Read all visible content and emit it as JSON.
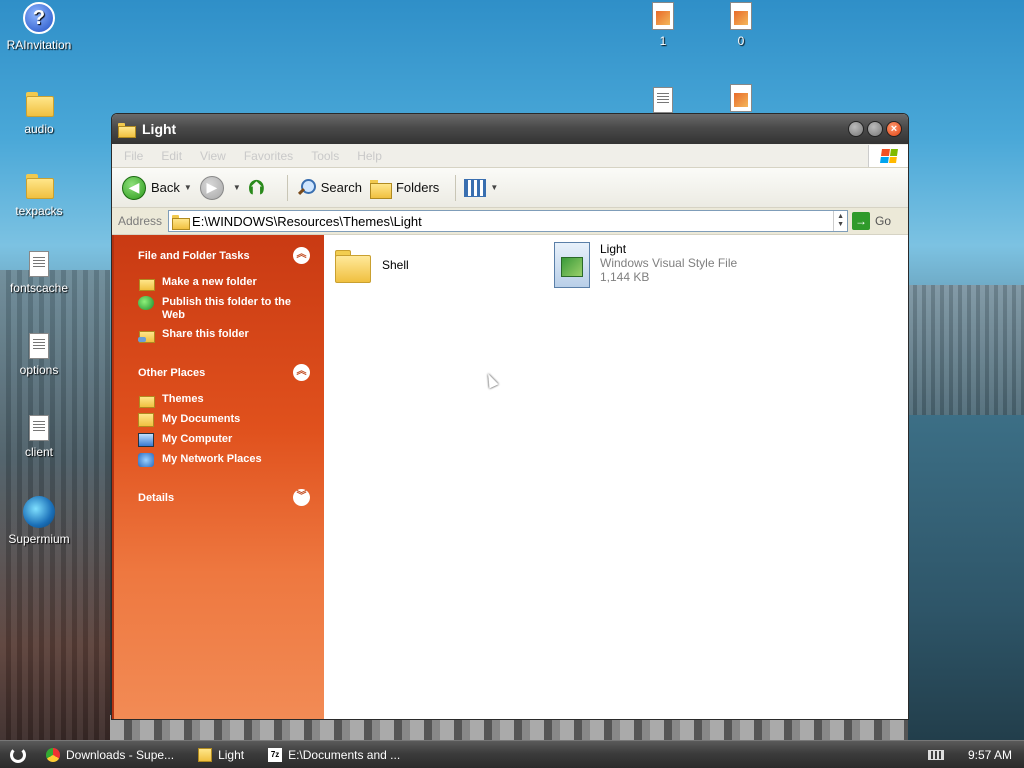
{
  "desktop": {
    "icons": [
      {
        "label": "RAInvitation",
        "icon": "help-icon"
      },
      {
        "label": "audio",
        "icon": "folder-icon"
      },
      {
        "label": "texpacks",
        "icon": "folder-icon"
      },
      {
        "label": "fontscache",
        "icon": "document-icon"
      },
      {
        "label": "options",
        "icon": "document-icon"
      },
      {
        "label": "client",
        "icon": "document-icon"
      },
      {
        "label": "Supermium",
        "icon": "globe-icon"
      },
      {
        "label": "1",
        "icon": "image-icon"
      },
      {
        "label": "0",
        "icon": "image-icon"
      }
    ]
  },
  "window": {
    "title": "Light",
    "menu": [
      "File",
      "Edit",
      "View",
      "Favorites",
      "Tools",
      "Help"
    ],
    "toolbar": {
      "back_label": "Back",
      "search_label": "Search",
      "folders_label": "Folders"
    },
    "address": {
      "label": "Address",
      "value": "E:\\WINDOWS\\Resources\\Themes\\Light",
      "go_label": "Go"
    },
    "taskpane": {
      "file_tasks": {
        "title": "File and Folder Tasks",
        "items": [
          "Make a new folder",
          "Publish this folder to the Web",
          "Share this folder"
        ]
      },
      "other_places": {
        "title": "Other Places",
        "items": [
          "Themes",
          "My Documents",
          "My Computer",
          "My Network Places"
        ]
      },
      "details": {
        "title": "Details"
      }
    },
    "files": [
      {
        "name": "Shell",
        "icon": "folder-icon"
      },
      {
        "name": "Light",
        "type": "Windows Visual Style File",
        "size": "1,144 KB",
        "icon": "msstyles-file-icon"
      }
    ]
  },
  "taskbar": {
    "buttons": [
      {
        "label": "Downloads - Supe...",
        "icon": "chrome-icon"
      },
      {
        "label": "Light",
        "icon": "folder-icon"
      },
      {
        "label": "E:\\Documents and ...",
        "icon": "7zip-icon"
      }
    ],
    "clock": "9:57 AM"
  }
}
